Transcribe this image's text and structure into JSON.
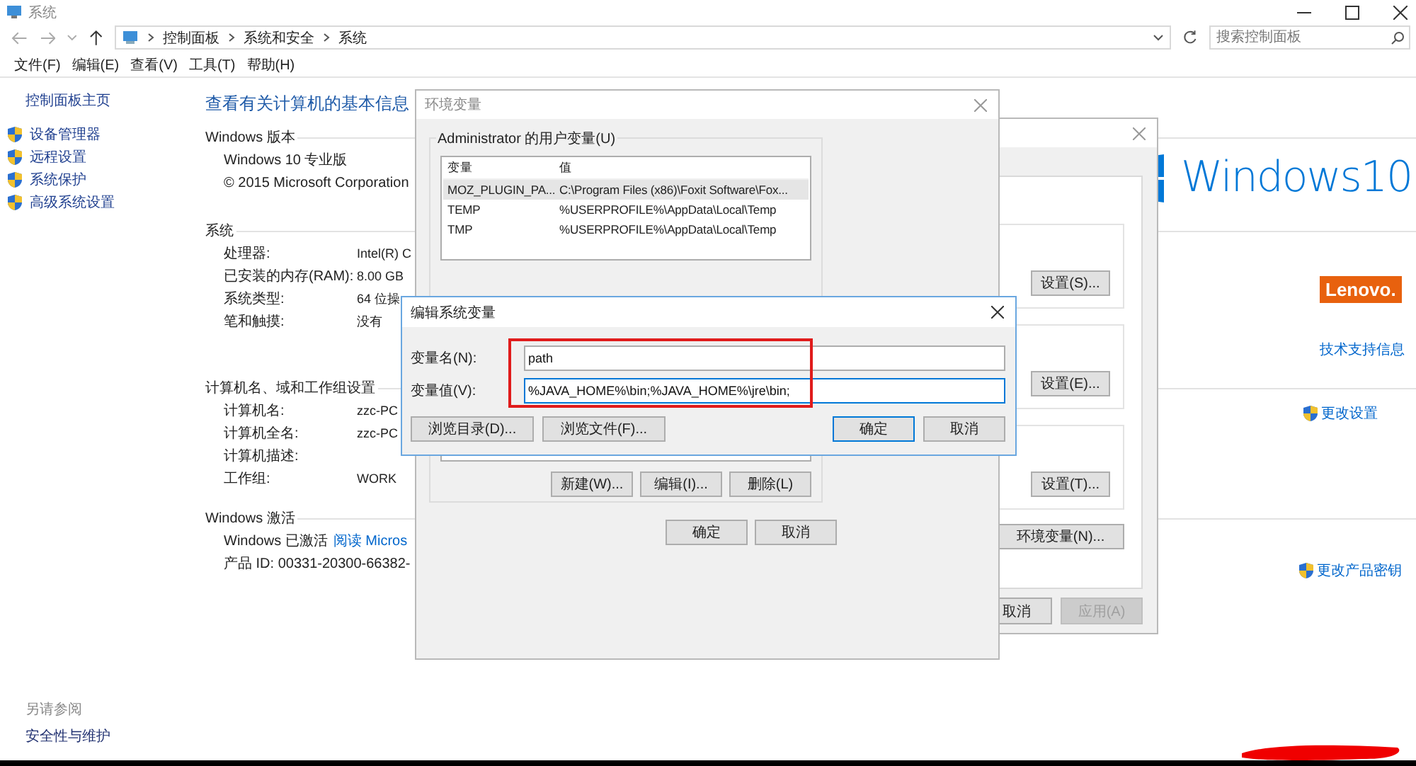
{
  "window": {
    "title": "系统"
  },
  "address_bar": {
    "breadcrumb": [
      "控制面板",
      "系统和安全",
      "系统"
    ],
    "search": {
      "placeholder": "搜索控制面板"
    }
  },
  "menu": [
    "文件(F)",
    "编辑(E)",
    "查看(V)",
    "工具(T)",
    "帮助(H)"
  ],
  "sidebar": {
    "home": "控制面板主页",
    "items": [
      "设备管理器",
      "远程设置",
      "系统保护",
      "高级系统设置"
    ],
    "see_also_title": "另请参阅",
    "see_also": [
      "安全性与维护"
    ]
  },
  "main": {
    "heading": "查看有关计算机的基本信息",
    "sections": [
      {
        "title": "Windows 版本",
        "rows": [
          {
            "kind": "text",
            "text": "Windows 10 专业版"
          },
          {
            "kind": "text",
            "text": "© 2015 Microsoft Corporation"
          }
        ],
        "aside": [
          {
            "kind": "logo",
            "text": "Windows10"
          }
        ]
      },
      {
        "title": "系统",
        "rows": [
          {
            "kind": "pair",
            "label": "处理器:",
            "value": "Intel(R) C"
          },
          {
            "kind": "pair",
            "label": "已安装的内存(RAM):",
            "value": "8.00 GB"
          },
          {
            "kind": "pair",
            "label": "系统类型:",
            "value": "64 位操"
          },
          {
            "kind": "pair",
            "label": "笔和触摸:",
            "value": "没有"
          }
        ],
        "aside": [
          {
            "kind": "badge",
            "text": "Lenovo."
          },
          {
            "kind": "link",
            "text": "技术支持信息"
          }
        ]
      },
      {
        "title": "计算机名、域和工作组设置",
        "rows": [
          {
            "kind": "pair",
            "label": "计算机名:",
            "value": "zzc-PC"
          },
          {
            "kind": "pair",
            "label": "计算机全名:",
            "value": "zzc-PC"
          },
          {
            "kind": "pair",
            "label": "计算机描述:"
          },
          {
            "kind": "pair",
            "label": "工作组:",
            "value": "WORK"
          }
        ],
        "aside": [
          {
            "kind": "shield-link",
            "text": "更改设置"
          }
        ]
      },
      {
        "title": "Windows 激活",
        "rows": [
          {
            "kind": "activation",
            "text": "Windows 已激活",
            "link": "阅读 Micros"
          },
          {
            "kind": "text",
            "text": "产品 ID: 00331-20300-66382-"
          }
        ],
        "aside": [
          {
            "kind": "shield-link",
            "text": "更改产品密钥"
          }
        ]
      }
    ]
  },
  "system_properties": {
    "settings_buttons": [
      "设置(S)...",
      "设置(E)...",
      "设置(T)..."
    ],
    "env_button": "环境变量(N)...",
    "footer": [
      {
        "label": "取消",
        "disabled": false
      },
      {
        "label": "应用(A)",
        "disabled": true
      }
    ]
  },
  "env_dialog": {
    "title": "环境变量",
    "user_group": "Administrator 的用户变量(U)",
    "columns": [
      "变量",
      "值"
    ],
    "rows": [
      {
        "name": "MOZ_PLUGIN_PA...",
        "value": "C:\\Program Files (x86)\\Foxit Software\\Fox...",
        "selected": true
      },
      {
        "name": "TEMP",
        "value": "%USERPROFILE%\\AppData\\Local\\Temp",
        "selected": false
      },
      {
        "name": "TMP",
        "value": "%USERPROFILE%\\AppData\\Local\\Temp",
        "selected": false
      }
    ],
    "system_buttons": [
      "新建(W)...",
      "编辑(I)...",
      "删除(L)"
    ],
    "buttons": [
      "确定",
      "取消"
    ]
  },
  "edit_dialog": {
    "title": "编辑系统变量",
    "fields": [
      {
        "label": "变量名(N):",
        "value": "path",
        "focused": false
      },
      {
        "label": "变量值(V):",
        "value": "%JAVA_HOME%\\bin;%JAVA_HOME%\\jre\\bin;",
        "focused": true
      }
    ],
    "browse_buttons": [
      "浏览目录(D)...",
      "浏览文件(F)..."
    ],
    "ok": "确定",
    "cancel": "取消"
  },
  "annotation": {
    "kind": "frame"
  }
}
